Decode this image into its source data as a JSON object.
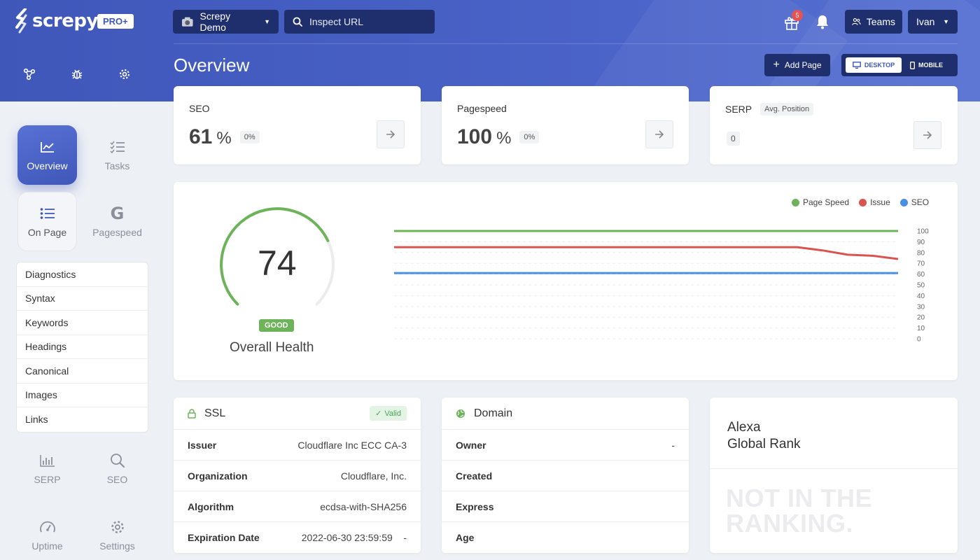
{
  "app": {
    "logo_text": "screpy",
    "plan_badge": "PRO+"
  },
  "header": {
    "project": "Screpy Demo",
    "search_placeholder": "Inspect URL",
    "gift_count": "5",
    "teams_label": "Teams",
    "user_name": "Ivan"
  },
  "page": {
    "title": "Overview",
    "add_page_label": "Add Page",
    "view_desktop": "DESKTOP",
    "view_mobile": "MOBILE",
    "active_view": "desktop"
  },
  "sidebar": {
    "tiles": [
      {
        "label": "Overview",
        "icon": "chart-line-icon"
      },
      {
        "label": "Tasks",
        "icon": "checklist-icon"
      },
      {
        "label": "On Page",
        "icon": "list-icon"
      },
      {
        "label": "Pagespeed",
        "icon": "google-icon"
      },
      {
        "label": "SERP",
        "icon": "bar-chart-icon"
      },
      {
        "label": "SEO",
        "icon": "search-icon"
      },
      {
        "label": "Uptime",
        "icon": "speedometer-icon"
      },
      {
        "label": "Settings",
        "icon": "gear-icon"
      }
    ],
    "submenu": [
      "Diagnostics",
      "Syntax",
      "Keywords",
      "Headings",
      "Canonical",
      "Images",
      "Links"
    ]
  },
  "metrics": {
    "seo": {
      "title": "SEO",
      "value": "61",
      "unit": "%",
      "change": "0%"
    },
    "pagespeed": {
      "title": "Pagespeed",
      "value": "100",
      "unit": "%",
      "change": "0%"
    },
    "serp": {
      "title": "SERP",
      "badge": "Avg. Position",
      "value": "0"
    }
  },
  "health": {
    "score": "74",
    "score_fraction": 0.74,
    "status": "GOOD",
    "label": "Overall Health"
  },
  "chart_data": {
    "type": "line",
    "y_ticks": [
      "100",
      "90",
      "80",
      "70",
      "60",
      "50",
      "40",
      "30",
      "20",
      "10",
      "0"
    ],
    "ylim": [
      0,
      100
    ],
    "legend_position": "top-right",
    "grid": true,
    "x": [
      0,
      1,
      2,
      3,
      4,
      5,
      6,
      7,
      8,
      9,
      10,
      11,
      12,
      13,
      14,
      15,
      16,
      17,
      18,
      19,
      20
    ],
    "series": [
      {
        "name": "Page Speed",
        "color": "#6db35a",
        "values": [
          100,
          100,
          100,
          100,
          100,
          100,
          100,
          100,
          100,
          100,
          100,
          100,
          100,
          100,
          100,
          100,
          100,
          100,
          100,
          100,
          100
        ]
      },
      {
        "name": "Issue",
        "color": "#d9534f",
        "values": [
          85,
          85,
          85,
          85,
          85,
          85,
          85,
          85,
          85,
          85,
          85,
          85,
          85,
          85,
          85,
          85,
          85,
          82,
          78,
          77,
          74
        ]
      },
      {
        "name": "SEO",
        "color": "#4a90e2",
        "values": [
          61,
          61,
          61,
          61,
          61,
          61,
          61,
          61,
          61,
          61,
          61,
          61,
          61,
          61,
          61,
          61,
          61,
          61,
          61,
          61,
          61
        ]
      }
    ]
  },
  "ssl": {
    "title": "SSL",
    "status": "Valid",
    "rows": [
      {
        "key": "Issuer",
        "value": "Cloudflare Inc ECC CA-3"
      },
      {
        "key": "Organization",
        "value": "Cloudflare, Inc."
      },
      {
        "key": "Algorithm",
        "value": "ecdsa-with-SHA256"
      },
      {
        "key": "Expiration Date",
        "value": "2022-06-30 23:59:59    -"
      }
    ]
  },
  "domain": {
    "title": "Domain",
    "rows": [
      {
        "key": "Owner",
        "value": "-"
      },
      {
        "key": "Created",
        "value": ""
      },
      {
        "key": "Express",
        "value": ""
      },
      {
        "key": "Age",
        "value": ""
      }
    ]
  },
  "alexa": {
    "title_line1": "Alexa",
    "title_line2": "Global Rank",
    "rank_line1": "NOT IN THE",
    "rank_line2": "RANKING."
  },
  "colors": {
    "brand": "#3f57b9",
    "brand_dark": "#1f2f6e",
    "good": "#6db35a"
  }
}
